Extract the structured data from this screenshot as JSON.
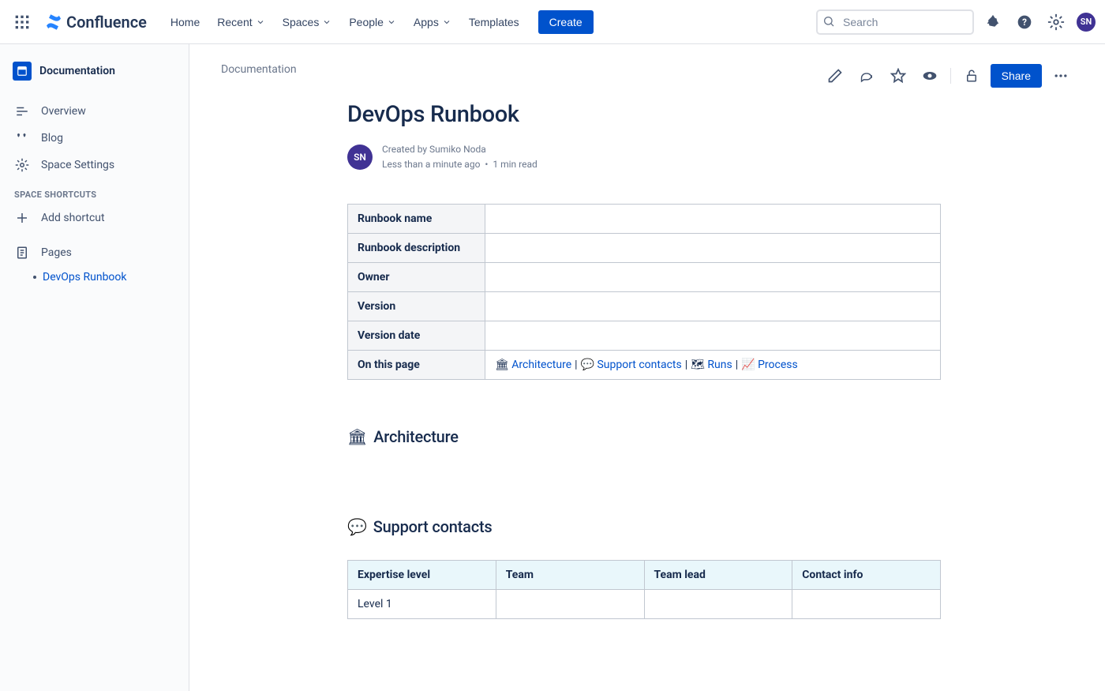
{
  "brand": {
    "name": "Confluence"
  },
  "nav": {
    "home": "Home",
    "recent": "Recent",
    "spaces": "Spaces",
    "people": "People",
    "apps": "Apps",
    "templates": "Templates",
    "create": "Create",
    "search_placeholder": "Search"
  },
  "user": {
    "initials": "SN"
  },
  "sidebar": {
    "space_name": "Documentation",
    "overview": "Overview",
    "blog": "Blog",
    "settings": "Space Settings",
    "shortcuts_heading": "Space Shortcuts",
    "add_shortcut": "Add shortcut",
    "pages": "Pages",
    "tree": {
      "current": "DevOps Runbook"
    }
  },
  "page": {
    "breadcrumb": "Documentation",
    "title": "DevOps Runbook",
    "created_by_prefix": "Created by ",
    "author": "Sumiko Noda",
    "time_ago": "Less than a minute ago",
    "read_time": "1 min read",
    "share": "Share"
  },
  "meta_table": {
    "runbook_name": "Runbook name",
    "runbook_desc": "Runbook description",
    "owner": "Owner",
    "version": "Version",
    "version_date": "Version date",
    "on_this_page": "On this page",
    "toc": {
      "arch_emoji": "🏛",
      "arch": "Architecture",
      "support_emoji": "💬",
      "support": "Support contacts",
      "runs_emoji": "🗺",
      "runs": "Runs",
      "process_emoji": "📈",
      "process": "Process"
    }
  },
  "sections": {
    "arch_emoji": "🏛",
    "arch": "Architecture",
    "support_emoji": "💬",
    "support": "Support contacts"
  },
  "contacts_table": {
    "h_expertise": "Expertise level",
    "h_team": "Team",
    "h_lead": "Team lead",
    "h_contact": "Contact info",
    "row1_level": "Level 1"
  }
}
